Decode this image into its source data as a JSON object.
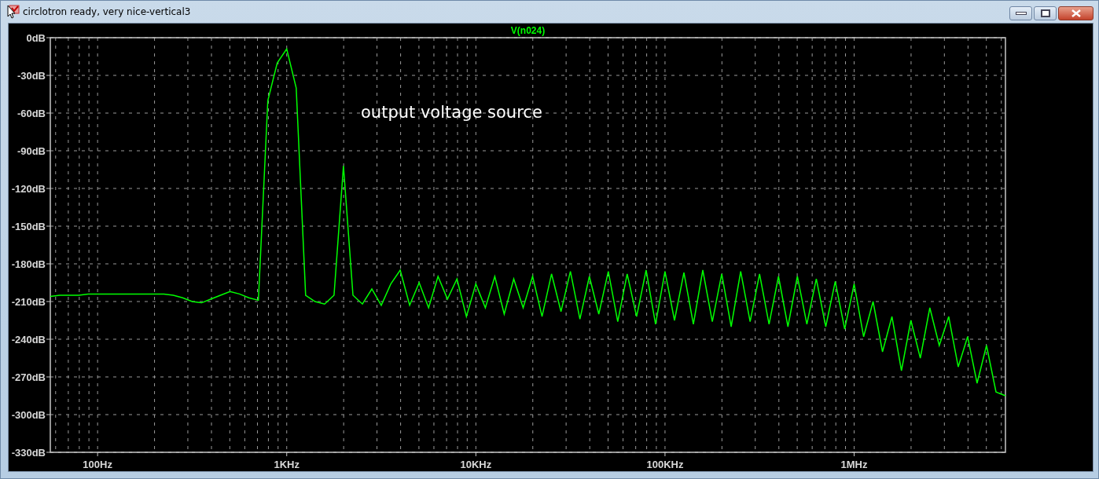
{
  "window": {
    "title": "circlotron ready, very nice-vertical3"
  },
  "plot": {
    "chart_data": {
      "type": "line",
      "categories": [
        null,
        null,
        null,
        null,
        null,
        "100Hz",
        null,
        null,
        null,
        null,
        null,
        null,
        null,
        null,
        null,
        null,
        null,
        null,
        null,
        null,
        null,
        null,
        null,
        null,
        null,
        "1KHz",
        null,
        null,
        null,
        null,
        null,
        null,
        null,
        null,
        null,
        null,
        null,
        null,
        null,
        null,
        null,
        null,
        null,
        null,
        null,
        "10KHz",
        null,
        null,
        null,
        null,
        null,
        null,
        null,
        null,
        null,
        null,
        null,
        null,
        null,
        null,
        null,
        null,
        null,
        null,
        null,
        "100KHz",
        null,
        null,
        null,
        null,
        null,
        null,
        null,
        null,
        null,
        null,
        null,
        null,
        null,
        null,
        null,
        null,
        null,
        null,
        null,
        "1MHz",
        null,
        null,
        null,
        null,
        null,
        null,
        null,
        null,
        null,
        null,
        null,
        null,
        null,
        null,
        null,
        null
      ],
      "series": [
        {
          "name": "V(n024)",
          "color": "#00ff00",
          "values": [
            -206,
            -205,
            -205,
            -205,
            -204,
            -204,
            -204,
            -204,
            -204,
            -204,
            -204,
            -204,
            -204,
            -205,
            -207,
            -210,
            -211,
            -208,
            -205,
            -202,
            -204,
            -207,
            -209,
            -50,
            -20,
            -9,
            -40,
            -205,
            -210,
            -212,
            -205,
            -102,
            -205,
            -212,
            -200,
            -213,
            -196,
            -185,
            -213,
            -195,
            -215,
            -190,
            -208,
            -192,
            -222,
            -196,
            -215,
            -190,
            -220,
            -192,
            -215,
            -190,
            -222,
            -188,
            -218,
            -186,
            -224,
            -190,
            -220,
            -186,
            -226,
            -188,
            -222,
            -185,
            -228,
            -186,
            -225,
            -187,
            -228,
            -185,
            -226,
            -188,
            -230,
            -186,
            -226,
            -188,
            -228,
            -190,
            -230,
            -190,
            -228,
            -192,
            -230,
            -194,
            -232,
            -196,
            -238,
            -210,
            -250,
            -222,
            -265,
            -225,
            -255,
            -215,
            -245,
            -222,
            -262,
            -238,
            -275,
            -245,
            -282,
            -285
          ]
        }
      ],
      "ylim": [
        -330,
        0
      ],
      "grid": true,
      "yticks": [
        {
          "value": 0,
          "label": "0dB"
        },
        {
          "value": -30,
          "label": "-30dB"
        },
        {
          "value": -60,
          "label": "-60dB"
        },
        {
          "value": -90,
          "label": "-90dB"
        },
        {
          "value": -120,
          "label": "-120dB"
        },
        {
          "value": -150,
          "label": "-150dB"
        },
        {
          "value": -180,
          "label": "-180dB"
        },
        {
          "value": -210,
          "label": "-210dB"
        },
        {
          "value": -240,
          "label": "-240dB"
        },
        {
          "value": -270,
          "label": "-270dB"
        },
        {
          "value": -300,
          "label": "-300dB"
        },
        {
          "value": -330,
          "label": "-330dB"
        }
      ],
      "annotations": [
        "output voltage source"
      ]
    }
  }
}
